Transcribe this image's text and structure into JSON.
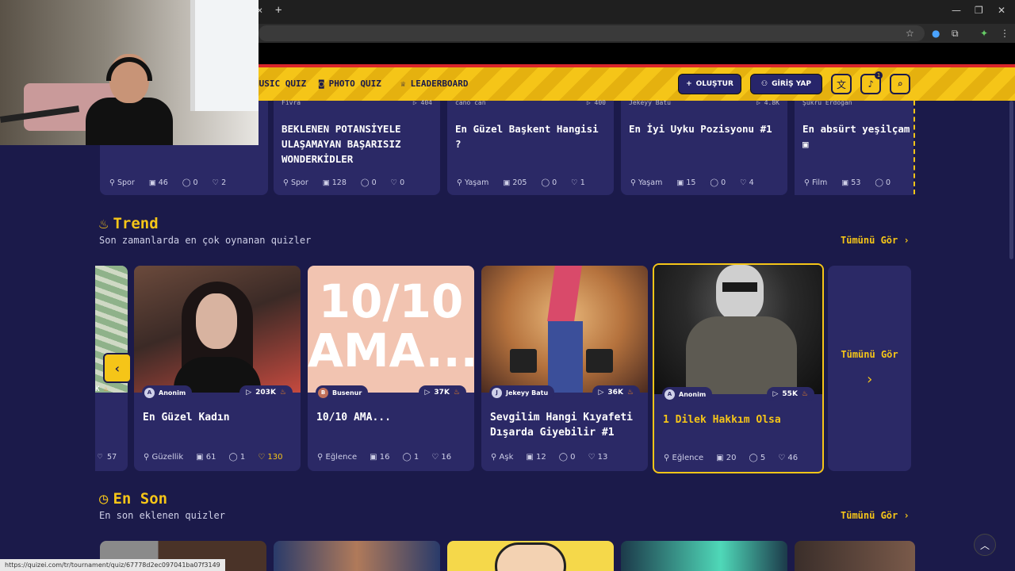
{
  "browser": {
    "tab_close": "×",
    "tab_new": "+",
    "status_url": "https://quizei.com/tr/tournament/quiz/67778d2ec097041ba07f3149"
  },
  "nav": {
    "music_quiz": "MUSIC QUIZ",
    "photo_quiz": "PHOTO QUIZ",
    "leaderboard": "LEADERBOARD",
    "create": "OLUŞTUR",
    "login": "GİRİŞ YAP",
    "notif_count": "1"
  },
  "row1": [
    {
      "author": "Fivra",
      "plays": "404",
      "title": "BEKLENEN POTANSİYELE ULAŞAMAYAN BAŞARISIZ WONDERKİDLER",
      "category": "Spor",
      "questions": "128",
      "comments": "0",
      "likes": "0"
    },
    {
      "author": "cano can",
      "plays": "400",
      "title": "En Güzel Başkent Hangisi ?",
      "category": "Yaşam",
      "questions": "205",
      "comments": "0",
      "likes": "1"
    },
    {
      "author": "Jekeyy Batu",
      "plays": "4.8K",
      "title": "En İyi Uyku Pozisyonu #1",
      "category": "Yaşam",
      "questions": "15",
      "comments": "0",
      "likes": "4"
    },
    {
      "author": "Şükrü Erdoğan",
      "plays": "",
      "title": "En absürt yeşilçam sahnesi",
      "category": "Film",
      "questions": "53",
      "comments": "0",
      "likes": ""
    }
  ],
  "row1_first": {
    "category": "Spor",
    "questions": "46",
    "comments": "0",
    "likes": "2"
  },
  "trend": {
    "title": "Trend",
    "subtitle": "Son zamanlarda en çok oynanan quizler",
    "see_all": "Tümünü Gör",
    "partial_likes": "57",
    "partial_plays": "K",
    "cards": [
      {
        "author": "Anonim",
        "avatar": "A",
        "plays": "203K",
        "title": "En Güzel Kadın",
        "category": "Güzellik",
        "questions": "61",
        "comments": "1",
        "likes": "130"
      },
      {
        "author": "Busenur",
        "avatar": "B",
        "plays": "37K",
        "title": "10/10 AMA...",
        "category": "Eğlence",
        "questions": "16",
        "comments": "1",
        "likes": "16",
        "image_text_1": "10/10",
        "image_text_2": "AMA..."
      },
      {
        "author": "Jekeyy Batu",
        "avatar": "J",
        "plays": "36K",
        "title": "Sevgilim Hangi Kıyafeti Dışarda Giyebilir #1",
        "category": "Aşk",
        "questions": "12",
        "comments": "0",
        "likes": "13"
      },
      {
        "author": "Anonim",
        "avatar": "A",
        "plays": "55K",
        "title": "1 Dilek Hakkım Olsa",
        "category": "Eğlence",
        "questions": "20",
        "comments": "5",
        "likes": "46"
      }
    ],
    "more_label": "Tümünü Gör"
  },
  "latest": {
    "title": "En Son",
    "subtitle": "En son eklenen quizler",
    "see_all": "Tümünü Gör"
  },
  "colors": {
    "accent": "#f5c518",
    "bg": "#1b1a4a",
    "card": "#2b2966"
  }
}
